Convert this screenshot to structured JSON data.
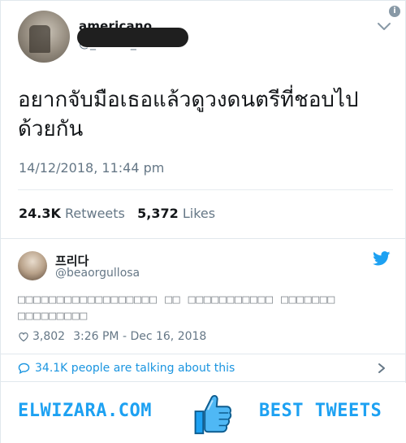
{
  "main_tweet": {
    "display_name": "americano",
    "handle": "@_0s2u7_",
    "text_line1": "อยากจับมือเธอแล้วดูวงดนตรีที่ชอบไป",
    "text_line2": "ด้วยกัน",
    "timestamp": "14/12/2018, 11:44 pm",
    "retweets_count": "24.3K",
    "retweets_label": "Retweets",
    "likes_count": "5,372",
    "likes_label": "Likes",
    "info_glyph": "i"
  },
  "reply_card": {
    "display_name": "프리다",
    "handle": "@beaorgullosa",
    "text_line1": "□□□□□□□□□□□□□□□□□□ □□ □□□□□□□□□□□ □□□□□□□",
    "text_line2": "□□□□□□□□□",
    "likes": "3,802",
    "time": "3:26 PM - Dec 16, 2018"
  },
  "talking": {
    "text": "34.1K people are talking about this"
  },
  "footer": {
    "brand_left": "ELWIZARA.COM",
    "brand_right": "BEST TWEETS"
  },
  "colors": {
    "accent": "#1da1f2",
    "link": "#1b95e0",
    "muted": "#657786",
    "text": "#14171a"
  },
  "icons": [
    "info-icon",
    "chevron-down-icon",
    "twitter-bird-icon",
    "heart-icon",
    "speech-bubble-icon",
    "chevron-right-icon",
    "thumbs-up-icon"
  ]
}
